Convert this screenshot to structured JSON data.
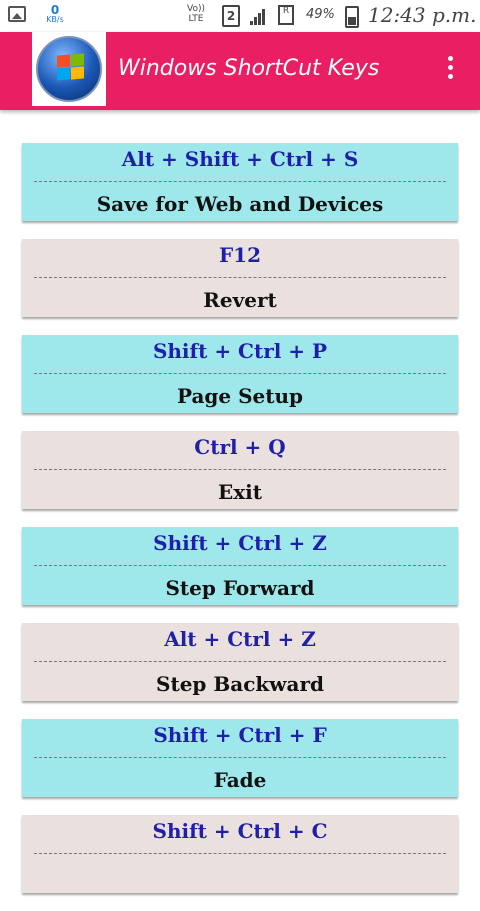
{
  "status_bar": {
    "speed_value": "0",
    "speed_unit": "KB/s",
    "network_top": "Vo))",
    "network_bottom": "LTE",
    "sim_slot": "2",
    "roaming": "R",
    "battery_percent": "49%",
    "time": "12:43 p.m."
  },
  "app_bar": {
    "title": "Windows ShortCut Keys"
  },
  "shortcuts": [
    {
      "keys": "Alt + Shift + Ctrl + S",
      "action": "Save for Web and Devices"
    },
    {
      "keys": "F12",
      "action": "Revert"
    },
    {
      "keys": "Shift + Ctrl + P",
      "action": "Page Setup"
    },
    {
      "keys": "Ctrl + Q",
      "action": "Exit"
    },
    {
      "keys": "Shift + Ctrl + Z",
      "action": "Step Forward"
    },
    {
      "keys": "Alt + Ctrl + Z",
      "action": "Step Backward"
    },
    {
      "keys": "Shift + Ctrl + F",
      "action": "Fade"
    },
    {
      "keys": "Shift + Ctrl + C",
      "action": ""
    }
  ],
  "colors": {
    "app_bar": "#e91e63",
    "card_cyan": "#9ee8ec",
    "card_beige": "#eae1df",
    "keys_text": "#1f1fa8"
  }
}
